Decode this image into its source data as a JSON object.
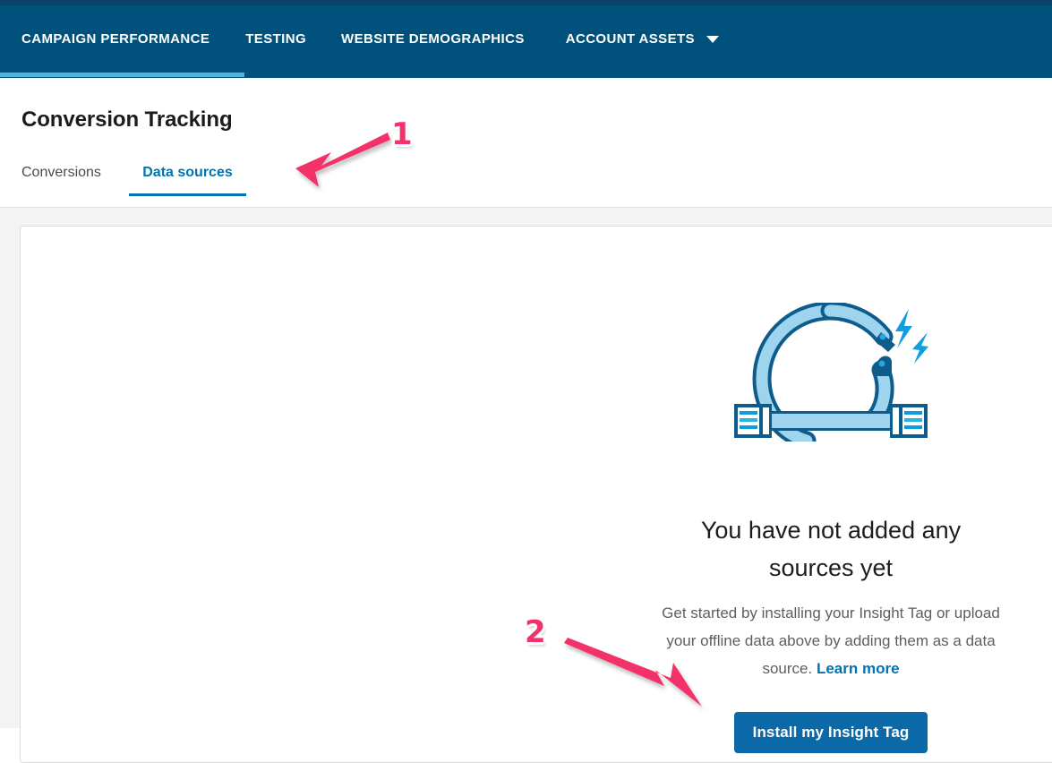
{
  "topnav": {
    "items": [
      {
        "label": "CAMPAIGN PERFORMANCE",
        "active": true
      },
      {
        "label": "TESTING",
        "active": false
      },
      {
        "label": "WEBSITE DEMOGRAPHICS",
        "active": false
      },
      {
        "label": "ACCOUNT ASSETS",
        "active": false,
        "icon": "chevron-down-icon"
      }
    ],
    "background_color": "#00527c",
    "active_indicator_color": "#4db6e0"
  },
  "page": {
    "title": "Conversion Tracking"
  },
  "subtabs": [
    {
      "label": "Conversions",
      "active": false
    },
    {
      "label": "Data sources",
      "active": true
    }
  ],
  "empty_state": {
    "illustration": "insight-tag-cable-icon",
    "title": "You have not added any sources yet",
    "description_part1": "Get started by installing your Insight Tag or upload your offline data above by adding them as a data source.",
    "learn_more_label": "Learn more",
    "install_button_label": "Install my Insight Tag"
  },
  "annotations": [
    {
      "number": "1",
      "target": "Data sources tab"
    },
    {
      "number": "2",
      "target": "Install my Insight Tag button"
    }
  ],
  "colors": {
    "brand_blue": "#0073b1",
    "nav_blue": "#00527c",
    "button_blue": "#0c69a8",
    "annotation_pink": "#f4326a",
    "page_background": "#f3f3f3"
  }
}
